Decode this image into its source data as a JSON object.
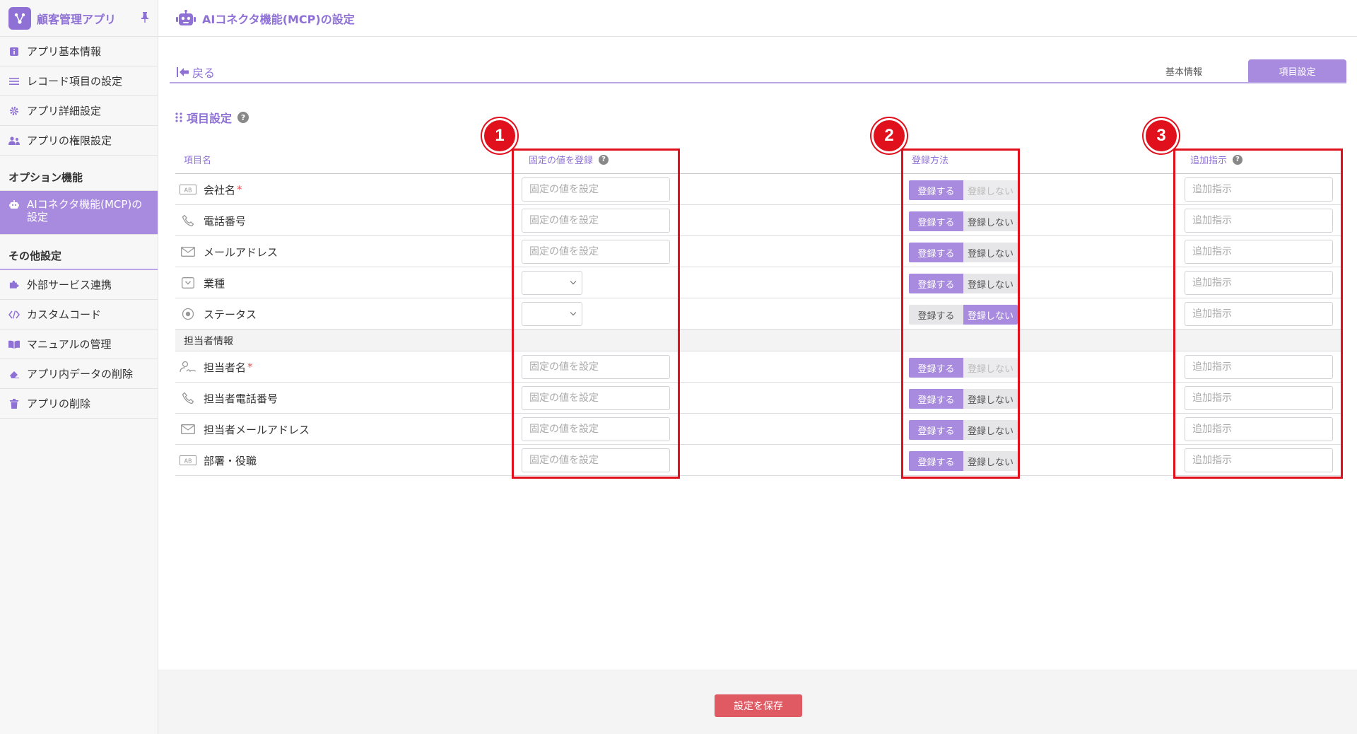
{
  "app": {
    "name": "顧客管理アプリ",
    "logo_icon": "network-icon",
    "accent": "#a88bde"
  },
  "sidebar": {
    "items_top": [
      {
        "label": "アプリ基本情報",
        "icon": "info-icon"
      },
      {
        "label": "レコード項目の設定",
        "icon": "list-icon"
      },
      {
        "label": "アプリ詳細設定",
        "icon": "gear-icon"
      },
      {
        "label": "アプリの権限設定",
        "icon": "users-icon"
      }
    ],
    "section_options": "オプション機能",
    "active_item": {
      "label": "AIコネクタ機能(MCP)の設定",
      "icon": "robot-icon"
    },
    "section_other": "その他設定",
    "items_other": [
      {
        "label": "外部サービス連携",
        "icon": "puzzle-icon"
      },
      {
        "label": "カスタムコード",
        "icon": "code-icon"
      },
      {
        "label": "マニュアルの管理",
        "icon": "book-icon"
      },
      {
        "label": "アプリ内データの削除",
        "icon": "eraser-icon"
      },
      {
        "label": "アプリの削除",
        "icon": "trash-icon"
      }
    ]
  },
  "header": {
    "title": "AIコネクタ機能(MCP)の設定"
  },
  "nav": {
    "back": "戻る",
    "tabs": [
      "基本情報",
      "項目設定"
    ]
  },
  "section": {
    "title": "項目設定"
  },
  "table": {
    "headers": {
      "name": "項目名",
      "fixed": "固定の値を登録",
      "method": "登録方法",
      "extra": "追加指示"
    },
    "fixed_placeholder": "固定の値を設定",
    "extra_placeholder": "追加指示",
    "toggle": {
      "on": "登録する",
      "off": "登録しない"
    },
    "group_label": "担当者情報"
  },
  "rows": [
    {
      "label": "会社名",
      "required": "*",
      "icon": "text-field-icon",
      "input": "text",
      "state": "on-locked"
    },
    {
      "label": "電話番号",
      "required": "",
      "icon": "phone-icon",
      "input": "text",
      "state": "on"
    },
    {
      "label": "メールアドレス",
      "required": "",
      "icon": "mail-icon",
      "input": "text",
      "state": "on"
    },
    {
      "label": "業種",
      "required": "",
      "icon": "dropdown-icon",
      "input": "select",
      "state": "on"
    },
    {
      "label": "ステータス",
      "required": "",
      "icon": "radio-icon",
      "input": "select",
      "state": "off"
    },
    {
      "label": "担当者名",
      "required": "*",
      "icon": "person-sign-icon",
      "input": "text",
      "state": "on-locked"
    },
    {
      "label": "担当者電話番号",
      "required": "",
      "icon": "phone-icon",
      "input": "text",
      "state": "on"
    },
    {
      "label": "担当者メールアドレス",
      "required": "",
      "icon": "mail-icon",
      "input": "text",
      "state": "on"
    },
    {
      "label": "部署・役職",
      "required": "",
      "icon": "text-field-icon",
      "input": "text",
      "state": "on"
    }
  ],
  "annotations": [
    "1",
    "2",
    "3"
  ],
  "footer": {
    "save": "設定を保存"
  }
}
